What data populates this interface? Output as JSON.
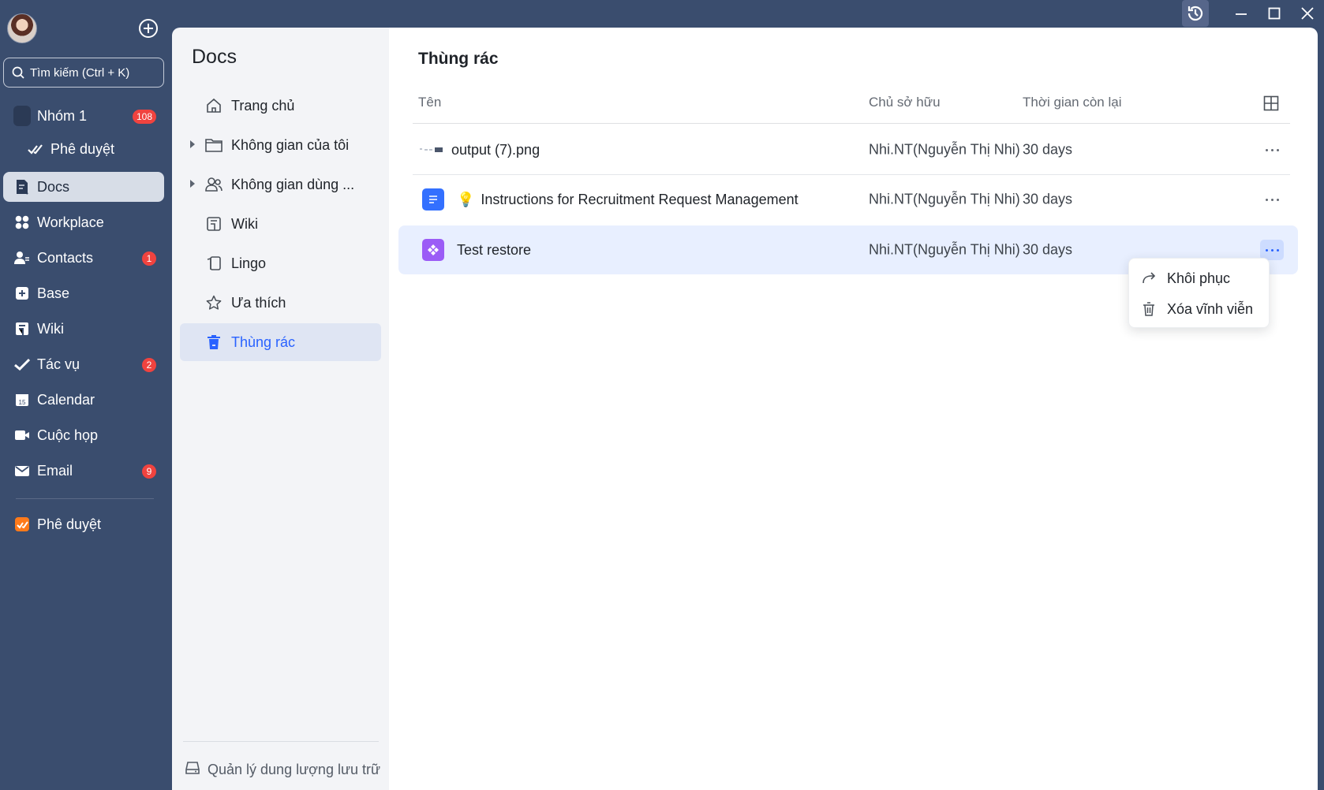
{
  "window": {
    "controls": [
      "history-icon",
      "minimize-icon",
      "maximize-icon",
      "close-icon"
    ]
  },
  "nav": {
    "search_label": "Tìm kiếm (Ctrl + K)",
    "items": [
      {
        "label": "Nhóm 1",
        "icon": "group-icon",
        "badge": "108"
      },
      {
        "label": "Phê duyệt",
        "icon": "approval-check-icon",
        "badge": ""
      },
      {
        "label": "Docs",
        "icon": "docs-icon",
        "badge": "",
        "active": true
      },
      {
        "label": "Workplace",
        "icon": "workplace-icon",
        "badge": ""
      },
      {
        "label": "Contacts",
        "icon": "contacts-icon",
        "badge": "1"
      },
      {
        "label": "Base",
        "icon": "base-icon",
        "badge": ""
      },
      {
        "label": "Wiki",
        "icon": "wiki-icon",
        "badge": ""
      },
      {
        "label": "Tác vụ",
        "icon": "tasks-icon",
        "badge": "2"
      },
      {
        "label": "Calendar",
        "icon": "calendar-icon",
        "badge": ""
      },
      {
        "label": "Cuộc họp",
        "icon": "meeting-icon",
        "badge": ""
      },
      {
        "label": "Email",
        "icon": "email-icon",
        "badge": "9"
      }
    ],
    "pinned": {
      "label": "Phê duyệt",
      "icon": "approval-app-icon"
    },
    "calendar_day": "15"
  },
  "docs": {
    "title": "Docs",
    "items": [
      {
        "label": "Trang chủ",
        "icon": "home-icon"
      },
      {
        "label": "Không gian của tôi",
        "icon": "folder-icon",
        "expandable": true
      },
      {
        "label": "Không gian dùng ...",
        "icon": "shared-space-icon",
        "expandable": true
      },
      {
        "label": "Wiki",
        "icon": "wiki-icon"
      },
      {
        "label": "Lingo",
        "icon": "lingo-icon"
      },
      {
        "label": "Ưa thích",
        "icon": "star-icon"
      },
      {
        "label": "Thùng rác",
        "icon": "trash-icon",
        "active": true
      }
    ],
    "footer": "Quản lý dung lượng lưu trữ"
  },
  "main": {
    "title": "Thùng rác",
    "columns": {
      "name": "Tên",
      "owner": "Chủ sở hữu",
      "remaining": "Thời gian còn lại"
    },
    "rows": [
      {
        "name": "output (7).png",
        "prefix": "",
        "owner": "Nhi.NT(Nguyễn Thị Nhi)",
        "remaining": "30 days",
        "type": "image"
      },
      {
        "name": "Instructions for Recruitment Request Management",
        "prefix": "💡",
        "owner": "Nhi.NT(Nguyễn Thị Nhi)",
        "remaining": "30 days",
        "type": "doc"
      },
      {
        "name": "Test restore",
        "prefix": "",
        "owner": "Nhi.NT(Nguyễn Thị Nhi)",
        "remaining": "30 days",
        "type": "base",
        "selected": true
      }
    ]
  },
  "context_menu": {
    "items": [
      {
        "label": "Khôi phục",
        "icon": "restore-icon"
      },
      {
        "label": "Xóa vĩnh viễn",
        "icon": "delete-icon"
      }
    ]
  },
  "colors": {
    "nav_bg": "#3a4d6e",
    "accent": "#2962ff",
    "badge": "#f0433f",
    "selected_row": "#e8efff"
  }
}
